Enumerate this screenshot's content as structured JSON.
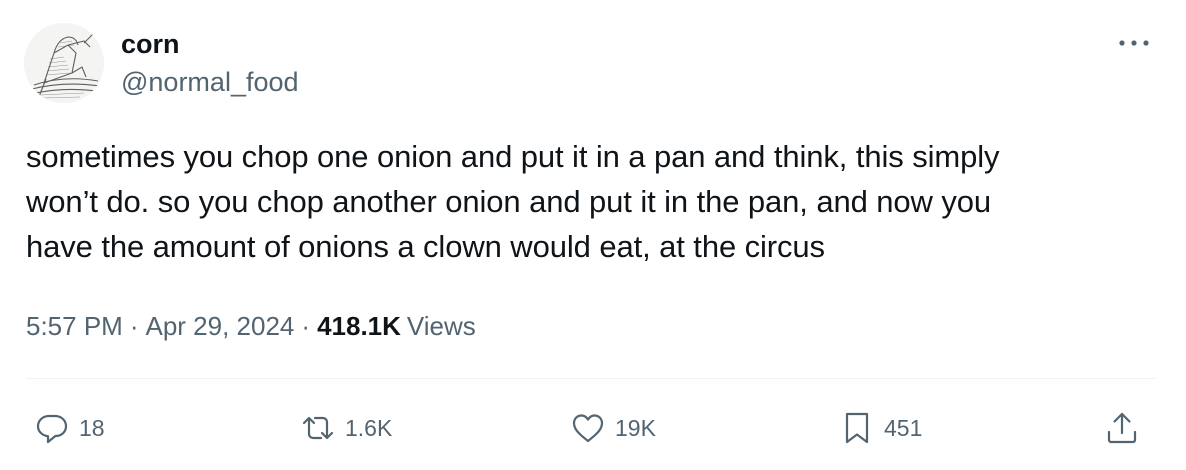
{
  "author": {
    "display_name": "corn",
    "handle": "@normal_food"
  },
  "tweet": {
    "lines": [
      "sometimes you chop one onion and put it in a pan and think, this simply",
      "won’t do. so you chop another onion and put it in the pan, and now you",
      "have the amount of onions a clown would eat, at the circus"
    ],
    "time": "5:57 PM",
    "separator": "·",
    "date": "Apr 29, 2024",
    "views_count": "418.1K",
    "views_label": "Views"
  },
  "actions": {
    "replies": "18",
    "retweets": "1.6K",
    "likes": "19K",
    "bookmarks": "451"
  },
  "icons": {
    "more": "more-horizontal-icon",
    "reply": "reply-icon",
    "retweet": "retweet-icon",
    "like": "heart-icon",
    "bookmark": "bookmark-icon",
    "share": "share-icon"
  },
  "colors": {
    "text_primary": "#0f1419",
    "text_secondary": "#536471",
    "divider": "#eff3f4"
  }
}
